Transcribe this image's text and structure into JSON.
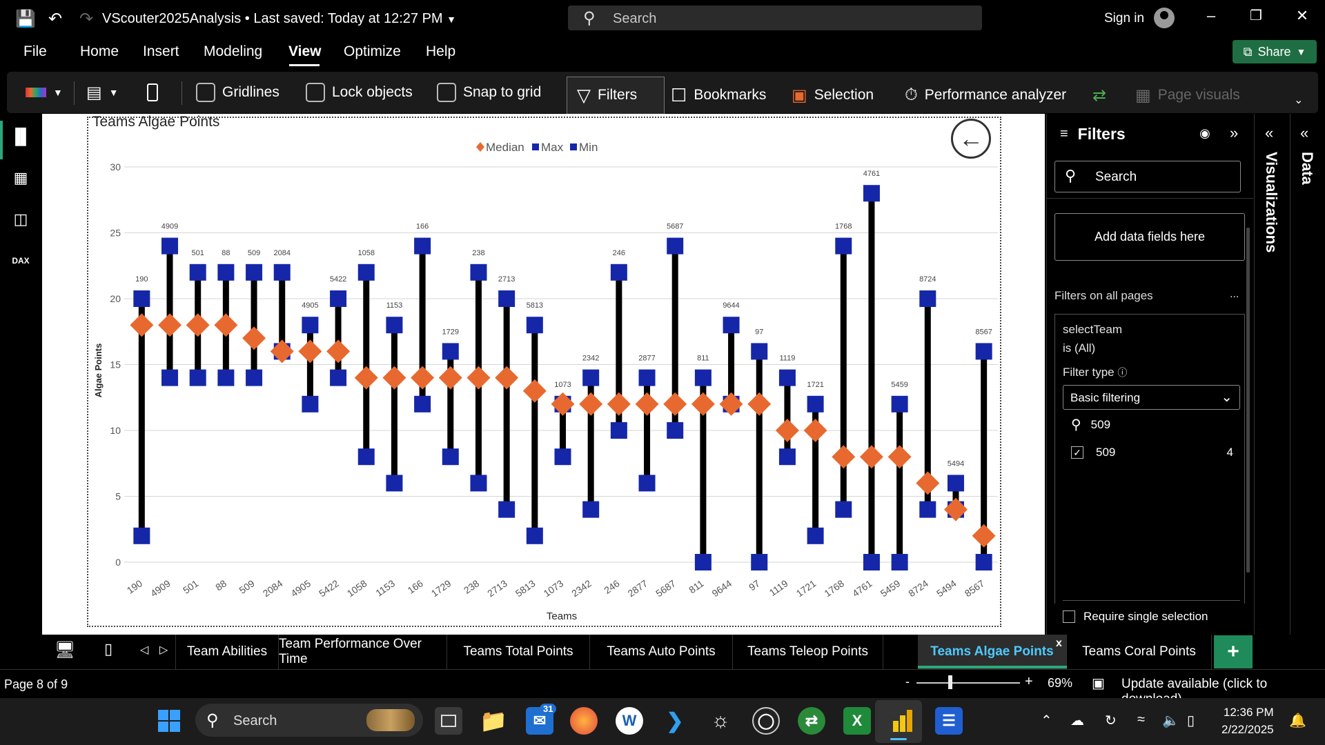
{
  "titlebar": {
    "doc_title": "VScouter2025Analysis • Last saved: Today at 12:27 PM",
    "search_placeholder": "Search",
    "signin": "Sign in"
  },
  "menu": {
    "items": [
      "File",
      "Home",
      "Insert",
      "Modeling",
      "View",
      "Optimize",
      "Help"
    ],
    "active": "View",
    "share_label": "Share"
  },
  "ribbon": {
    "gridlines": "Gridlines",
    "lock_objects": "Lock objects",
    "snap_to_grid": "Snap to grid",
    "filters": "Filters",
    "bookmarks": "Bookmarks",
    "selection": "Selection",
    "performance_analyzer": "Performance analyzer",
    "page_visuals": "Page visuals"
  },
  "chart_data": {
    "type": "scatter",
    "title": "Teams Algae Points",
    "xlabel": "Teams",
    "ylabel": "Algae Points",
    "ylim": [
      0,
      30
    ],
    "yticks": [
      0,
      5,
      10,
      15,
      20,
      25,
      30
    ],
    "legend": [
      "Median",
      "Max",
      "Min"
    ],
    "legend_placement": "top-center",
    "colors": {
      "median": "#e8692f",
      "max": "#1527a8",
      "min": "#1527a8",
      "bar": "#000000"
    },
    "categories": [
      "190",
      "4909",
      "501",
      "88",
      "509",
      "2084",
      "4905",
      "5422",
      "1058",
      "1153",
      "166",
      "1729",
      "238",
      "2713",
      "5813",
      "1073",
      "2342",
      "246",
      "2877",
      "5687",
      "811",
      "9644",
      "97",
      "1119",
      "1721",
      "1768",
      "4761",
      "5459",
      "8724",
      "5494",
      "8567"
    ],
    "series": [
      {
        "name": "Median",
        "values": [
          18,
          18,
          18,
          18,
          17,
          16,
          16,
          16,
          14,
          14,
          14,
          14,
          14,
          14,
          13,
          12,
          12,
          12,
          12,
          12,
          12,
          12,
          12,
          10,
          10,
          8,
          8,
          8,
          6,
          4,
          2
        ]
      },
      {
        "name": "Max",
        "values": [
          20,
          24,
          22,
          22,
          22,
          22,
          18,
          20,
          22,
          18,
          24,
          16,
          22,
          20,
          18,
          12,
          14,
          22,
          14,
          24,
          14,
          18,
          16,
          14,
          12,
          24,
          28,
          12,
          20,
          6,
          16
        ]
      },
      {
        "name": "Min",
        "values": [
          2,
          14,
          14,
          14,
          14,
          16,
          12,
          14,
          8,
          6,
          12,
          8,
          6,
          4,
          2,
          8,
          4,
          10,
          6,
          10,
          0,
          12,
          0,
          8,
          2,
          4,
          0,
          0,
          4,
          4,
          0
        ]
      }
    ]
  },
  "filters_pane": {
    "title": "Filters",
    "search_placeholder": "Search",
    "add_fields": "Add data fields here",
    "all_pages": "Filters on all pages",
    "more": "...",
    "field_name": "selectTeam",
    "field_state": "is (All)",
    "filter_type_label": "Filter type",
    "filter_type_value": "Basic filtering",
    "value_search": "509",
    "value_item": "509",
    "value_count": "4",
    "require_single": "Require single selection"
  },
  "side_panes": {
    "visualizations": "Visualizations",
    "data": "Data"
  },
  "page_tabs": {
    "tabs": [
      "Team Abilities",
      "Team Performance Over Time",
      "Teams Total Points",
      "Teams Auto Points",
      "Teams Teleop Points",
      "Teams Algae Points",
      "Teams Coral Points"
    ],
    "active": "Teams Algae Points",
    "close": "x"
  },
  "status": {
    "page": "Page 8 of 9",
    "zoom_minus": "-",
    "zoom_plus": "+",
    "zoom": "69%",
    "update": "Update available (click to download)"
  },
  "taskbar": {
    "search": "Search",
    "time": "12:36 PM",
    "date": "2/22/2025",
    "badge": "31"
  }
}
